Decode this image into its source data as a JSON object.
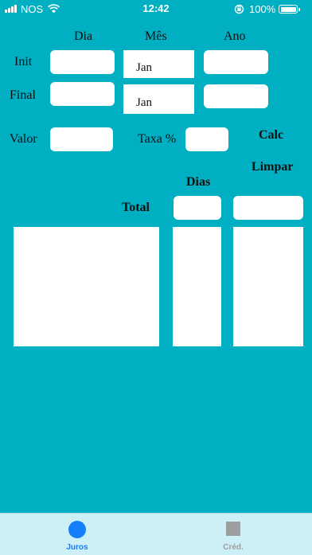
{
  "status_bar": {
    "carrier": "NOS",
    "time": "12:42",
    "battery": "100%"
  },
  "form": {
    "col_dia": "Dia",
    "col_mes": "Mês",
    "col_ano": "Ano",
    "init_label": "Init",
    "final_label": "Final",
    "init_month_value": "Jan",
    "final_month_value": "Jan",
    "valor_label": "Valor",
    "taxa_label": "Taxa %",
    "calc_button": "Calc",
    "limpar_button": "Limpar",
    "dias_label": "Dias",
    "total_label": "Total"
  },
  "tabbar": {
    "tabs": [
      {
        "label": "Juros",
        "icon": "circle-icon",
        "active": true,
        "color": "#147EFB"
      },
      {
        "label": "Créd.",
        "icon": "square-icon",
        "active": false,
        "color": "#9E9E9E"
      }
    ]
  },
  "colors": {
    "background": "#00AFC1",
    "accent": "#147EFB"
  }
}
